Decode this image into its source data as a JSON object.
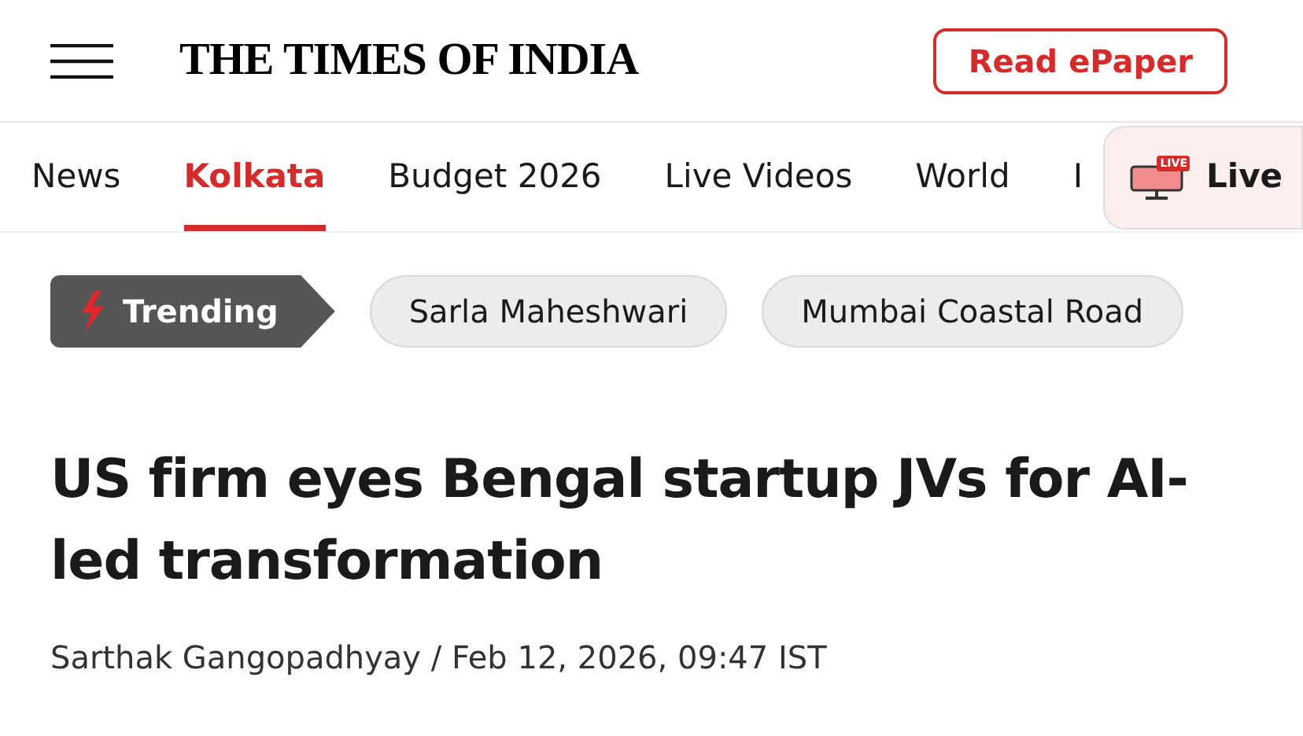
{
  "header": {
    "logo": "THE TIMES OF INDIA",
    "epaper_button": "Read ePaper"
  },
  "nav": {
    "items": [
      {
        "label": "News",
        "selected": false
      },
      {
        "label": "Kolkata",
        "selected": true
      },
      {
        "label": "Budget 2026",
        "selected": false
      },
      {
        "label": "Live Videos",
        "selected": false
      },
      {
        "label": "World",
        "selected": false
      },
      {
        "label": "I",
        "selected": false
      }
    ],
    "live_button": {
      "badge": "LIVE",
      "label": "Live"
    }
  },
  "trending": {
    "label": "Trending",
    "tags": [
      "Sarla Maheshwari",
      "Mumbai Coastal Road"
    ]
  },
  "article": {
    "headline": "US firm eyes Bengal startup JVs for AI-led transformation",
    "byline": "Sarthak Gangopadhyay / Feb 12, 2026, 09:47 IST"
  }
}
